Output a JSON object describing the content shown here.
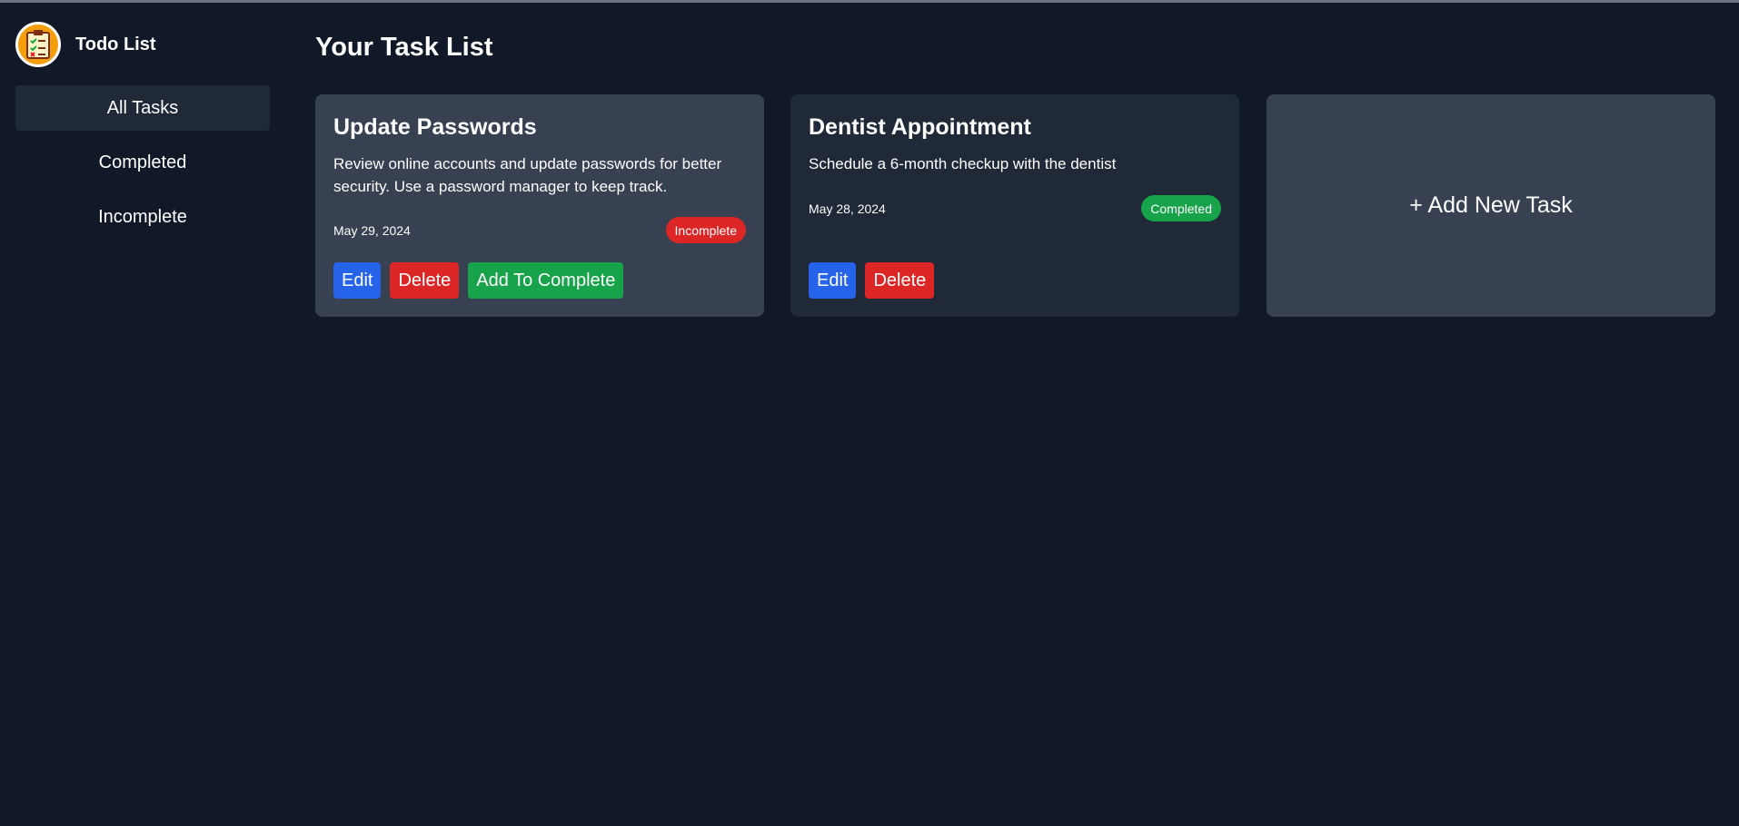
{
  "app": {
    "title": "Todo List"
  },
  "sidebar": {
    "items": [
      {
        "label": "All Tasks",
        "active": true
      },
      {
        "label": "Completed",
        "active": false
      },
      {
        "label": "Incomplete",
        "active": false
      }
    ]
  },
  "main": {
    "title": "Your Task List",
    "tasks": [
      {
        "title": "Update Passwords",
        "description": "Review online accounts and update passwords for better security. Use a password manager to keep track.",
        "date": "May 29, 2024",
        "status": "Incomplete",
        "status_color": "#dc2626",
        "actions": {
          "edit": "Edit",
          "delete": "Delete",
          "complete": "Add To Complete"
        }
      },
      {
        "title": "Dentist Appointment",
        "description": "Schedule a 6-month checkup with the dentist",
        "date": "May 28, 2024",
        "status": "Completed",
        "status_color": "#16a34a",
        "actions": {
          "edit": "Edit",
          "delete": "Delete"
        }
      }
    ],
    "add_task_label": "+ Add New Task"
  },
  "colors": {
    "background": "#111827",
    "sidebar_active": "#1f2937",
    "card_primary": "#374151",
    "card_secondary": "#1f2937",
    "blue": "#2563eb",
    "red": "#dc2626",
    "green": "#16a34a",
    "logo": "#f59e0b"
  },
  "icons": {
    "logo": "clipboard-checklist-icon"
  }
}
